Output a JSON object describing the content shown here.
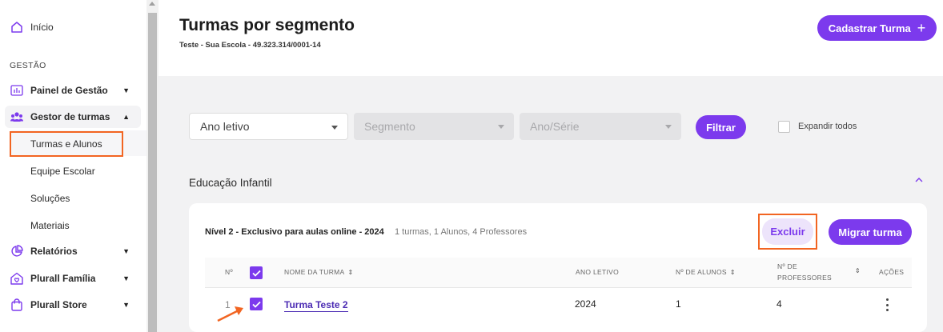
{
  "sidebar": {
    "inicio": "Início",
    "group_label": "GESTÃO",
    "items": [
      {
        "label": "Painel de Gestão",
        "icon": "dashboard-icon"
      },
      {
        "label": "Gestor de turmas",
        "icon": "users-icon"
      },
      {
        "label": "Relatórios",
        "icon": "pie-chart-icon"
      },
      {
        "label": "Plurall Família",
        "icon": "home-icon"
      },
      {
        "label": "Plurall Store",
        "icon": "shopping-bag-icon"
      }
    ],
    "subitems": [
      "Turmas e Alunos",
      "Equipe Escolar",
      "Soluções",
      "Materiais"
    ]
  },
  "header": {
    "title": "Turmas por segmento",
    "subtitle": "Teste - Sua Escola - 49.323.314/0001-14",
    "cadastrar_label": "Cadastrar Turma"
  },
  "filters": {
    "ano_letivo": "Ano letivo",
    "segmento": "Segmento",
    "ano_serie": "Ano/Série",
    "filtrar_label": "Filtrar",
    "expand_label": "Expandir todos"
  },
  "section": {
    "title": "Educação Infantil",
    "card_title": "Nível 2 - Exclusivo para aulas online - 2024",
    "card_meta": "1 turmas, 1 Alunos, 4 Professores",
    "excluir_label": "Excluir",
    "migrar_label": "Migrar turma"
  },
  "table": {
    "headers": {
      "num": "Nº",
      "nome": "NOME DA TURMA",
      "ano": "ANO LETIVO",
      "alunos": "Nº DE ALUNOS",
      "professores_1": "Nº DE",
      "professores_2": "PROFESSORES",
      "acoes": "AÇÕES"
    },
    "rows": [
      {
        "num": "1",
        "nome": "Turma Teste 2",
        "ano": "2024",
        "alunos": "1",
        "professores": "4"
      }
    ]
  },
  "colors": {
    "accent": "#7c3aed",
    "highlight": "#f26522"
  }
}
